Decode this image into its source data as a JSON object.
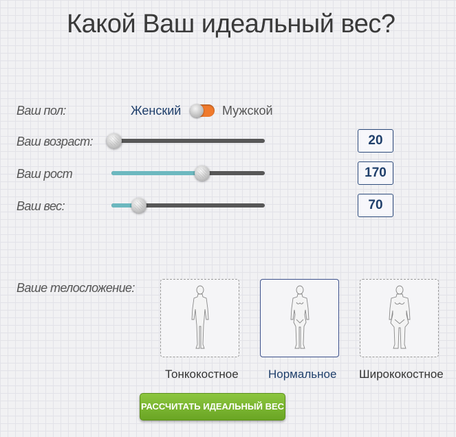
{
  "title": "Какой Ваш идеальный вес?",
  "gender": {
    "label": "Ваш пол:",
    "female": "Женский",
    "male": "Мужской",
    "selected": "male"
  },
  "age": {
    "label": "Ваш возраст:",
    "value": "20",
    "fraction": 0.0
  },
  "height": {
    "label": "Ваш рост",
    "value": "170",
    "fraction": 0.59
  },
  "weight": {
    "label": "Ваш вес:",
    "value": "70",
    "fraction": 0.18
  },
  "build": {
    "label": "Ваше телосложение:",
    "options": [
      {
        "label": "Тонкокостное",
        "selected": false
      },
      {
        "label": "Нормальное",
        "selected": true
      },
      {
        "label": "Ширококостное",
        "selected": false
      }
    ]
  },
  "calculate_button": "РАССЧИТАТЬ ИДЕАЛЬНЫЙ ВЕС",
  "colors": {
    "accent_blue": "#1f3f6b",
    "toggle_orange": "#f07a2c",
    "slider_fill": "#6cb8bf",
    "button_green": "#7bb531"
  },
  "icons": [
    "female-silhouette-thin-icon",
    "female-silhouette-normal-icon",
    "female-silhouette-wide-icon"
  ]
}
